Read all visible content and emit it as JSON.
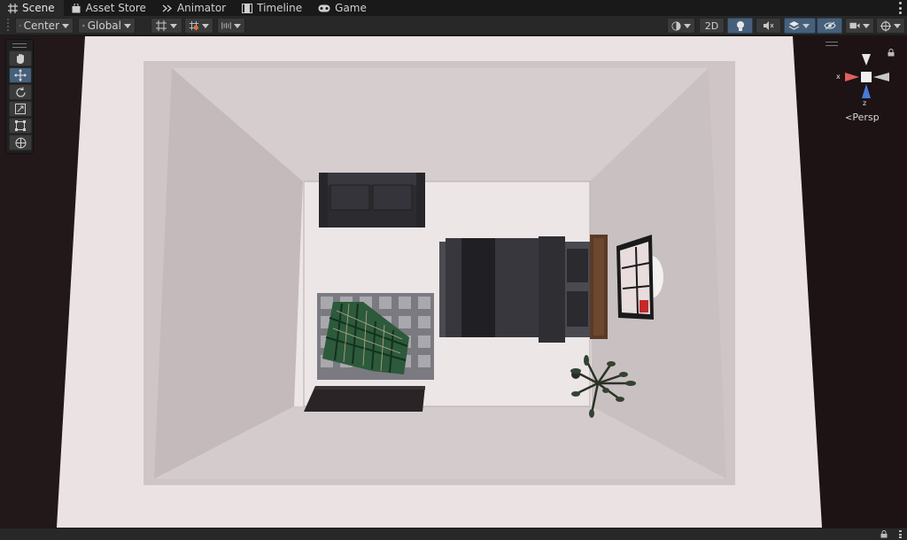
{
  "tabs": [
    {
      "label": "Scene",
      "icon": "grid-icon",
      "active": true
    },
    {
      "label": "Asset Store",
      "icon": "shopping-bag-icon",
      "active": false
    },
    {
      "label": "Animator",
      "icon": "animator-icon",
      "active": false
    },
    {
      "label": "Timeline",
      "icon": "film-icon",
      "active": false
    },
    {
      "label": "Game",
      "icon": "gamepad-icon",
      "active": false
    }
  ],
  "toolbar": {
    "pivot_label": "Center",
    "space_label": "Global",
    "mode_2d_label": "2D"
  },
  "gizmo": {
    "x_label": "x",
    "z_label": "z",
    "projection_label": "Persp"
  },
  "colors": {
    "accent_blue": "#46607c",
    "gizmo_x": "#e06060",
    "gizmo_z": "#4a7ad8"
  }
}
